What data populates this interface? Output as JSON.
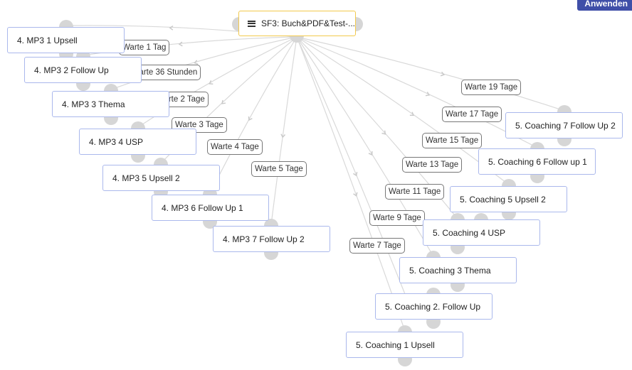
{
  "toolbar": {
    "apply_label": "Anwenden"
  },
  "root": {
    "icon": "list-icon",
    "title": "SF3: Buch&PDF&Test-..."
  },
  "mp3_nodes": [
    {
      "title": "4. MP3 1 Upsell",
      "wait": "Warte 1 Tag"
    },
    {
      "title": "4. MP3 2 Follow Up",
      "wait": "Warte 36 Stunden"
    },
    {
      "title": "4. MP3 3 Thema",
      "wait": "Warte 2 Tage"
    },
    {
      "title": "4. MP3 4 USP",
      "wait": "Warte 3 Tage"
    },
    {
      "title": "4. MP3 5 Upsell 2",
      "wait": "Warte 4 Tage"
    },
    {
      "title": "4. MP3 6 Follow Up 1",
      "wait": "Warte 5 Tage"
    },
    {
      "title": "4. MP3 7 Follow Up 2",
      "wait": ""
    }
  ],
  "coaching_nodes": [
    {
      "title": "5. Coaching 7 Follow Up 2",
      "wait": "Warte 19 Tage"
    },
    {
      "title": "5. Coaching 6 Follow up 1",
      "wait": "Warte 17 Tage"
    },
    {
      "title": "5. Coaching 5 Upsell 2",
      "wait": "Warte 15 Tage"
    },
    {
      "title": "5. Coaching 4 USP",
      "wait": "Warte 13 Tage"
    },
    {
      "title": "5. Coaching 3 Thema",
      "wait": "Warte 11 Tage"
    },
    {
      "title": "5. Coaching 2. Follow Up",
      "wait": "Warte 9 Tage"
    },
    {
      "title": "5. Coaching 1 Upsell",
      "wait": "Warte 7 Tage"
    }
  ],
  "colors": {
    "root_border": "#f2c94c",
    "node_border": "#aab8ec",
    "edge": "#d9d9d9",
    "port": "#d6d6d6",
    "button": "#3f4fa8"
  }
}
